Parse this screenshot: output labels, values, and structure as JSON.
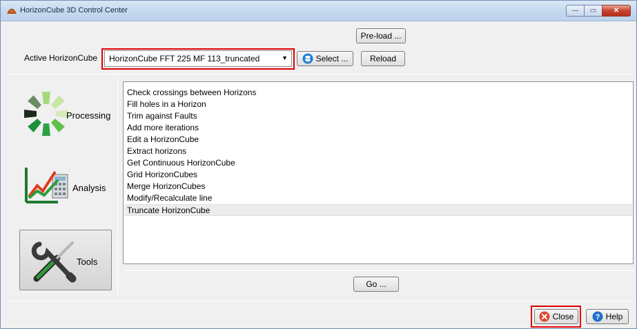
{
  "window": {
    "title": "HorizonCube 3D Control Center",
    "controls": {
      "minimize": "—",
      "maximize": "▭",
      "close": "✕"
    }
  },
  "toolbar": {
    "preload_label": "Pre-load ...",
    "active_label": "Active HorizonCube",
    "active_value": "HorizonCube FFT 225 MF 113_truncated",
    "select_label": "Select ...",
    "reload_label": "Reload"
  },
  "sidebar": {
    "items": [
      {
        "label": "Processing",
        "icon": "processing-wheel-icon",
        "selected": false
      },
      {
        "label": "Analysis",
        "icon": "chart-calculator-icon",
        "selected": false
      },
      {
        "label": "Tools",
        "icon": "wrench-screwdriver-icon",
        "selected": true
      }
    ]
  },
  "tools_list": [
    "Check crossings between Horizons",
    "Fill holes in a Horizon",
    "Trim against Faults",
    "Add more iterations",
    "Edit a HorizonCube",
    "Extract horizons",
    "Get Continuous HorizonCube",
    "Grid HorizonCubes",
    "Merge HorizonCubes",
    "Modify/Recalculate line",
    "Truncate HorizonCube"
  ],
  "selected_tool": "Truncate HorizonCube",
  "go_label": "Go ...",
  "footer": {
    "close_label": "Close",
    "help_label": "Help"
  },
  "colors": {
    "highlight_box": "#e00000",
    "titlebar": "#c5d8ee"
  }
}
